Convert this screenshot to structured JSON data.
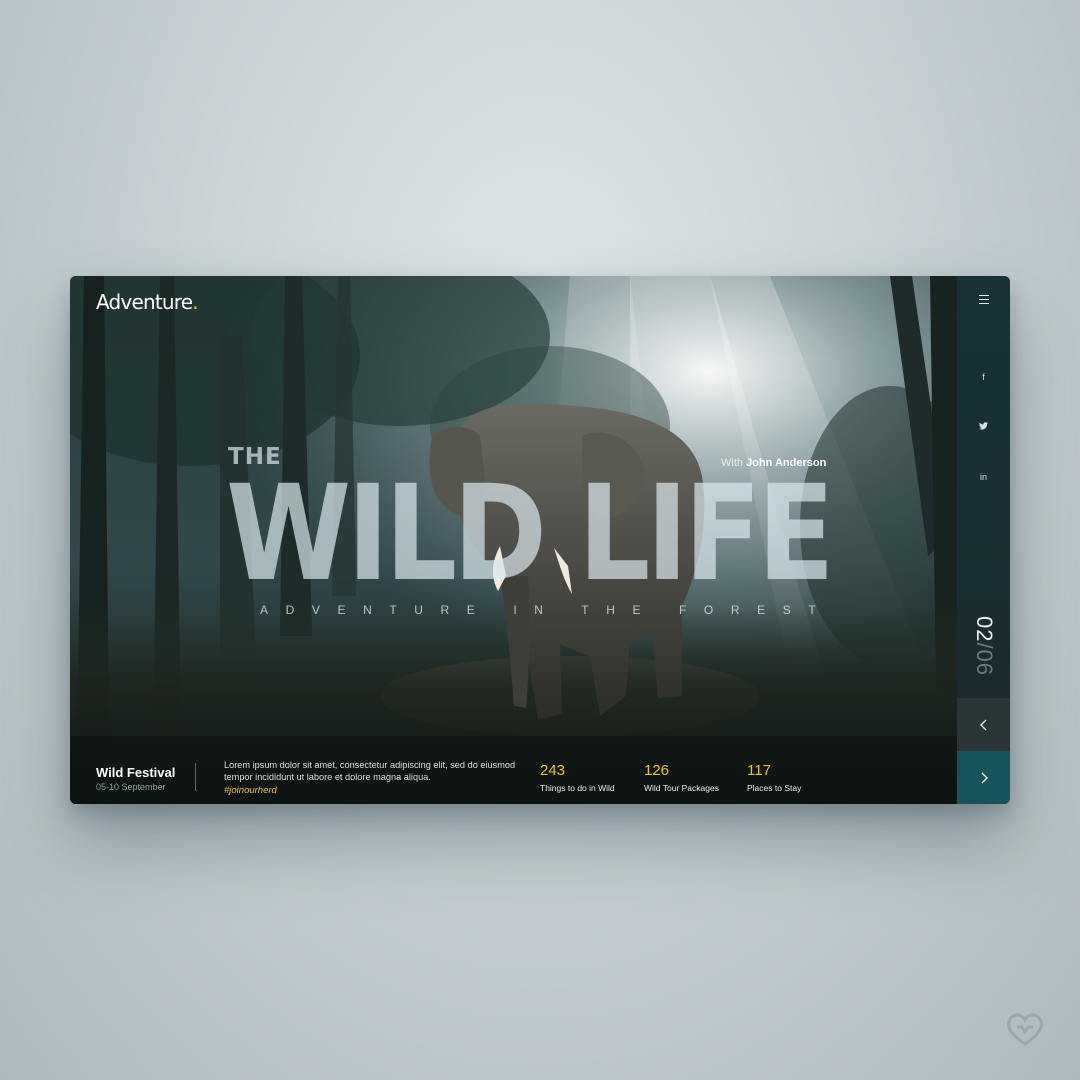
{
  "brand": {
    "name": "Adventure",
    "dot": ".",
    "accent_color": "#f0c419"
  },
  "hero": {
    "the": "THE",
    "title": "WILD LIFE",
    "tagline": "ADVENTURE IN THE FOREST",
    "with_prefix": "With",
    "with_name": "John Anderson"
  },
  "sidebar": {
    "menu_icon": "hamburger-menu-icon",
    "social": [
      {
        "icon": "facebook-icon",
        "glyph": "f"
      },
      {
        "icon": "twitter-icon",
        "glyph": "🐦"
      },
      {
        "icon": "linkedin-icon",
        "glyph": "in"
      }
    ],
    "slide_current": "02",
    "slide_total": "/06",
    "prev_icon": "chevron-left-icon",
    "next_icon": "chevron-right-icon"
  },
  "event": {
    "title": "Wild Festival",
    "date": "05-10 September",
    "description": "Lorem ipsum dolor sit amet, consectetur adipiscing elit, sed do eiusmod tempor incididunt ut labore et dolore magna aliqua.",
    "hashtag": "#joinourherd"
  },
  "stats": [
    {
      "value": "243",
      "label": "Things to do in Wild"
    },
    {
      "value": "126",
      "label": "Wild Tour Packages"
    },
    {
      "value": "117",
      "label": "Places to Stay"
    }
  ],
  "colors": {
    "next_button": "#17535b",
    "prev_button": "#2a3537",
    "sidebar": "#1a2d31",
    "stat_number": "#f0c419"
  },
  "watermark_icon": "heart-logo-icon"
}
